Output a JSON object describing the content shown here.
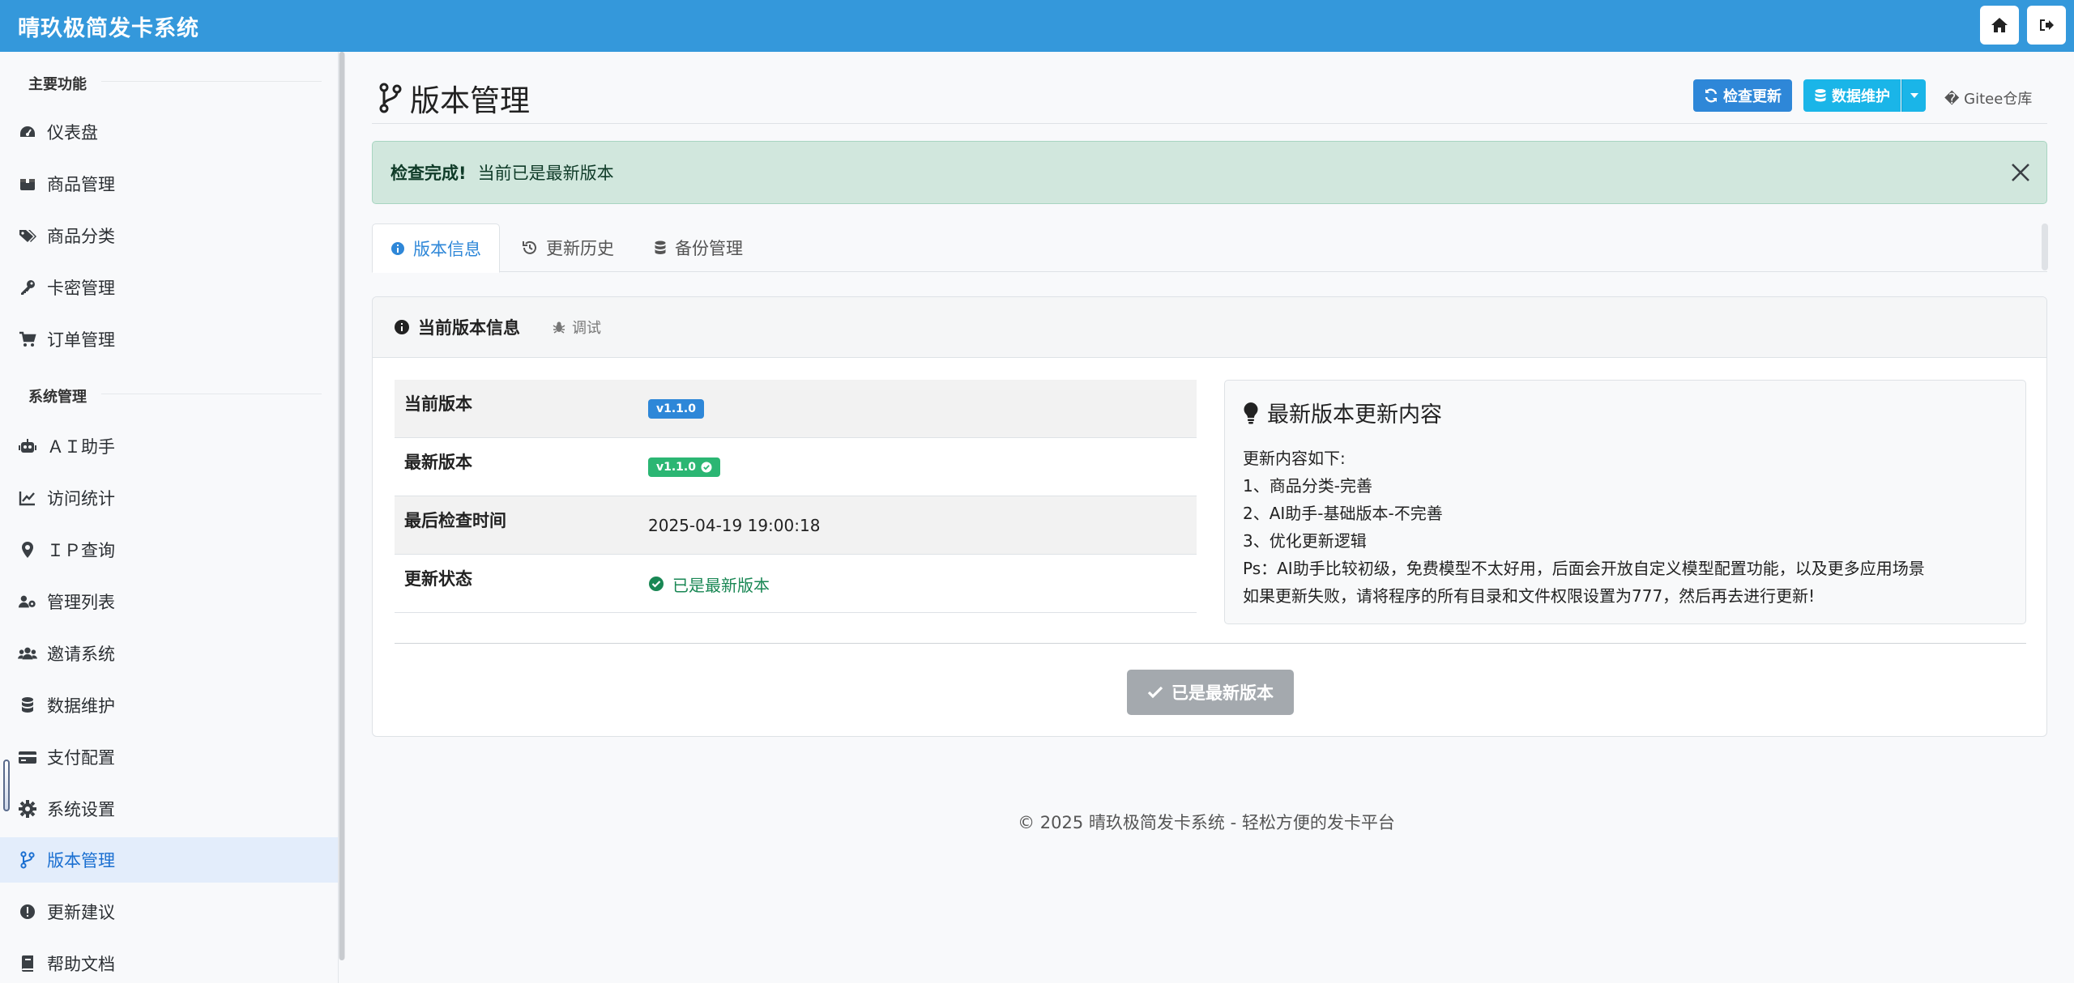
{
  "app": {
    "title": "晴玖极简发卡系统"
  },
  "sidebar": {
    "sections": [
      "主要功能",
      "系统管理"
    ],
    "items": [
      {
        "label": "仪表盘",
        "icon": "dashboard-icon"
      },
      {
        "label": "商品管理",
        "icon": "box-icon"
      },
      {
        "label": "商品分类",
        "icon": "tags-icon"
      },
      {
        "label": "卡密管理",
        "icon": "key-icon"
      },
      {
        "label": "订单管理",
        "icon": "cart-icon"
      },
      {
        "label": "ＡＩ助手",
        "icon": "robot-icon"
      },
      {
        "label": "访问统计",
        "icon": "chart-line-icon"
      },
      {
        "label": "ＩＰ查询",
        "icon": "map-pin-icon"
      },
      {
        "label": "管理列表",
        "icon": "users-cog-icon"
      },
      {
        "label": "邀请系统",
        "icon": "users-icon"
      },
      {
        "label": "数据维护",
        "icon": "database-icon"
      },
      {
        "label": "支付配置",
        "icon": "credit-card-icon"
      },
      {
        "label": "系统设置",
        "icon": "gear-icon"
      },
      {
        "label": "版本管理",
        "icon": "code-branch-icon",
        "active": true
      },
      {
        "label": "更新建议",
        "icon": "exclamation-circle-icon"
      },
      {
        "label": "帮助文档",
        "icon": "book-icon"
      }
    ]
  },
  "header": {
    "title": "版本管理",
    "check_update": "检查更新",
    "data_maintenance": "数据维护",
    "gitee": "� Gitee仓库"
  },
  "alert": {
    "strong": "检查完成!",
    "text": "当前已是最新版本"
  },
  "tabs": [
    "版本信息",
    "更新历史",
    "备份管理"
  ],
  "card": {
    "title": "当前版本信息",
    "debug": "调试",
    "rows": [
      {
        "key": "当前版本",
        "value": "v1.1.0"
      },
      {
        "key": "最新版本",
        "value": "v1.1.0"
      },
      {
        "key": "最后检查时间",
        "value": "2025-04-19 19:00:18"
      },
      {
        "key": "更新状态",
        "value": "已是最新版本"
      }
    ],
    "notes_title": "最新版本更新内容",
    "notes": [
      "更新内容如下:",
      "1、商品分类-完善",
      "2、AI助手-基础版本-不完善",
      "3、优化更新逻辑",
      "Ps：AI助手比较初级，免费模型不太好用，后面会开放自定义模型配置功能，以及更多应用场景",
      "如果更新失败，请将程序的所有目录和文件权限设置为777，然后再去进行更新!"
    ],
    "latest_button": "已是最新版本"
  },
  "footer": "© 2025 晴玖极简发卡系统 - 轻松方便的发卡平台",
  "colors": {
    "primary": "#3498db",
    "info": "#1ab5e8",
    "success": "#198754",
    "alert_bg": "#d1e7dd"
  }
}
